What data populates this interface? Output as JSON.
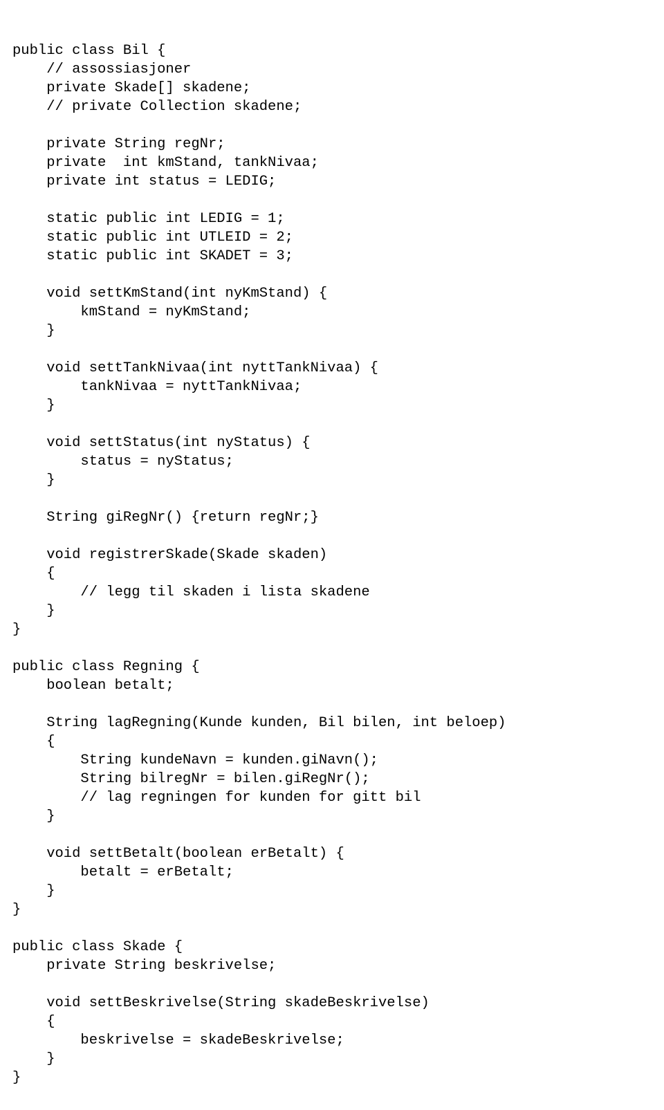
{
  "code": "public class Bil {\n    // assossiasjoner\n    private Skade[] skadene;\n    // private Collection skadene;\n\n    private String regNr;\n    private  int kmStand, tankNivaa;\n    private int status = LEDIG;\n\n    static public int LEDIG = 1;\n    static public int UTLEID = 2;\n    static public int SKADET = 3;\n\n    void settKmStand(int nyKmStand) {\n        kmStand = nyKmStand;\n    }\n\n    void settTankNivaa(int nyttTankNivaa) {\n        tankNivaa = nyttTankNivaa;\n    }\n\n    void settStatus(int nyStatus) {\n        status = nyStatus;\n    }\n\n    String giRegNr() {return regNr;}\n\n    void registrerSkade(Skade skaden)\n    {\n        // legg til skaden i lista skadene\n    }\n}\n\npublic class Regning {\n    boolean betalt;\n\n    String lagRegning(Kunde kunden, Bil bilen, int beloep)\n    {\n        String kundeNavn = kunden.giNavn();\n        String bilregNr = bilen.giRegNr();\n        // lag regningen for kunden for gitt bil\n    }\n\n    void settBetalt(boolean erBetalt) {\n        betalt = erBetalt;\n    }\n}\n\npublic class Skade {\n    private String beskrivelse;\n\n    void settBeskrivelse(String skadeBeskrivelse)\n    {\n        beskrivelse = skadeBeskrivelse;\n    }\n}"
}
